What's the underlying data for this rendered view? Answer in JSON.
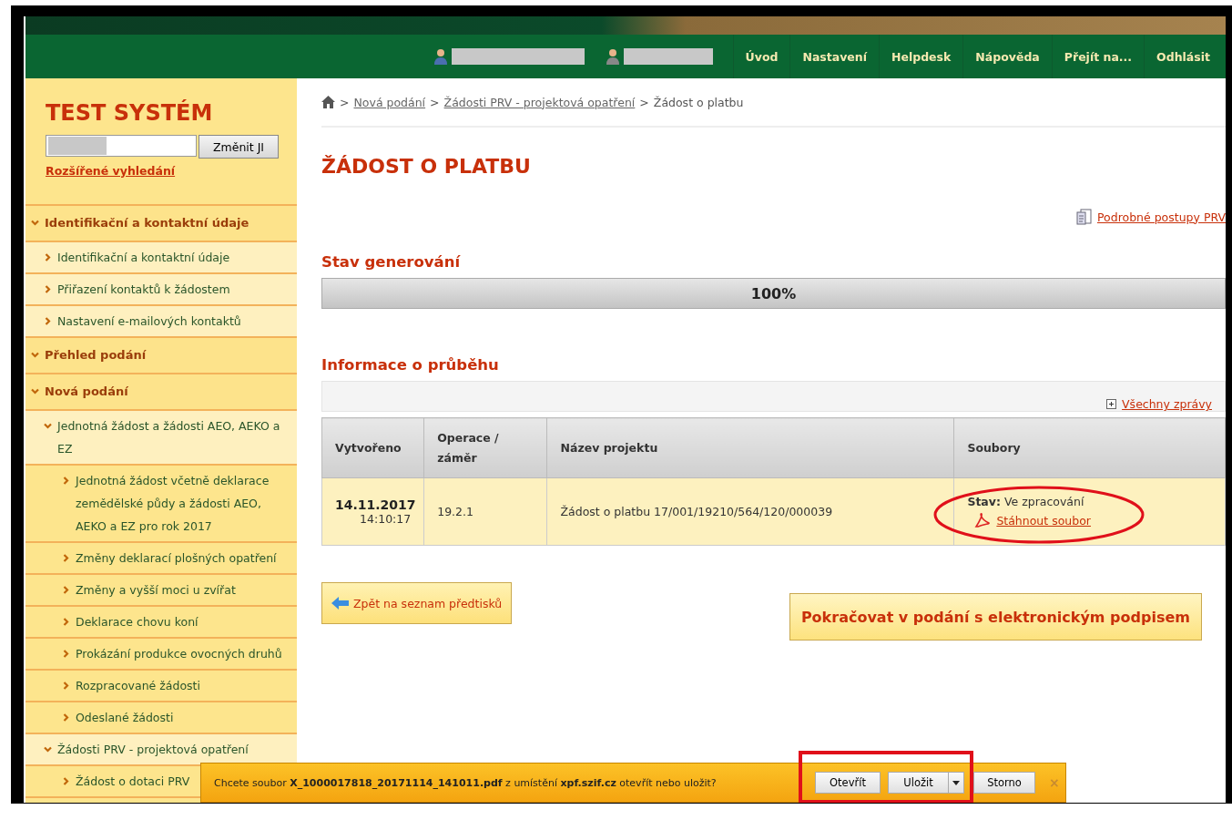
{
  "header": {
    "nav": [
      "Úvod",
      "Nastavení",
      "Helpdesk",
      "Nápověda",
      "Přejít na...",
      "Odhlásit"
    ]
  },
  "sidebar": {
    "title": "TEST SYSTÉM",
    "search_button": "Změnit JI",
    "advanced_link": "Rozšířené vyhledání",
    "sections": [
      {
        "label": "Identifikační a kontaktní údaje",
        "expanded": true,
        "children": [
          {
            "label": "Identifikační a kontaktní údaje"
          },
          {
            "label": "Přiřazení kontaktů k žádostem"
          },
          {
            "label": "Nastavení e-mailových kontaktů"
          }
        ]
      },
      {
        "label": "Přehled podání",
        "expanded": true
      },
      {
        "label": "Nová podání",
        "expanded": true,
        "children": [
          {
            "label": "Jednotná žádost a žádosti AEO, AEKO a EZ",
            "expanded": true,
            "children": [
              {
                "label": "Jednotná žádost včetně deklarace zemědělské půdy a žádosti AEO, AEKO a EZ pro rok 2017"
              },
              {
                "label": "Změny deklarací plošných opatření"
              },
              {
                "label": "Změny a vyšší moci u zvířat"
              },
              {
                "label": "Deklarace chovu koní"
              },
              {
                "label": "Prokázání produkce ovocných druhů"
              },
              {
                "label": "Rozpracované žádosti"
              },
              {
                "label": "Odeslané žádosti"
              }
            ]
          },
          {
            "label": "Žádosti PRV - projektová opatření",
            "expanded": true,
            "children": [
              {
                "label": "Žádost o dotaci PRV"
              }
            ]
          }
        ]
      }
    ]
  },
  "breadcrumb": [
    {
      "separator": ">",
      "text": "Nová podání",
      "kind": "link"
    },
    {
      "separator": ">",
      "text": "Žádosti PRV - projektová opatření",
      "kind": "link"
    },
    {
      "separator": ">",
      "text": "Žádost o platbu",
      "kind": "current"
    }
  ],
  "page_title": "ŽÁDOST O PLATBU",
  "procedures_link": "Podrobné postupy PRV",
  "generation": {
    "heading": "Stav generování",
    "level": 1,
    "reading": "100%"
  },
  "progress_info": {
    "heading": "Informace o průběhu",
    "all_messages_link": "Všechny zprávy"
  },
  "table": {
    "columns": [
      "Vytvořeno",
      "Operace / záměr",
      "Název projektu",
      "Soubory"
    ],
    "rows": [
      {
        "date": "14.11.2017",
        "time": "14:10:17",
        "operation": "19.2.1",
        "project": "Žádost o platbu 17/001/19210/564/120/000039",
        "status": "**Stav:** Ve zpracování",
        "file_link": "Stáhnout soubor"
      }
    ]
  },
  "back_button": "Zpět na seznam předtisků",
  "continue_button": "Pokračovat v podání s elektronickým podpisem",
  "download_bar": {
    "message": "Chcete soubor **X_1000017818_20171114_141011.pdf** z umístění **xpf.szif.cz** otevřít nebo uložit?",
    "buttons": [
      "Otevřít",
      "Uložit",
      "Storno"
    ],
    "close": "×"
  }
}
